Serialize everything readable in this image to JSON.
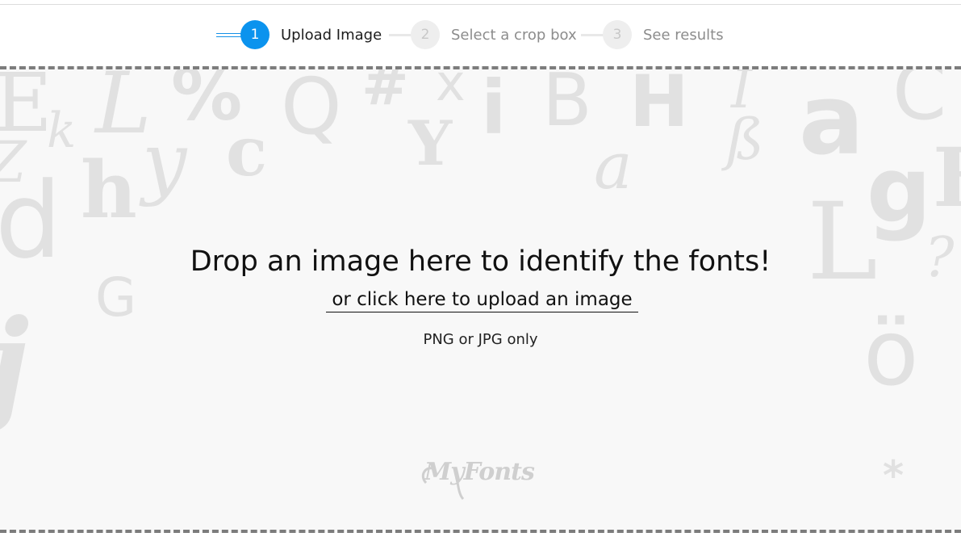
{
  "stepper": {
    "steps": [
      {
        "number": "1",
        "label": "Upload Image",
        "state": "active"
      },
      {
        "number": "2",
        "label": "Select a crop box",
        "state": "inactive"
      },
      {
        "number": "3",
        "label": "See results",
        "state": "inactive"
      }
    ],
    "active_color": "#0b93ee"
  },
  "dropzone": {
    "headline": "Drop an image here to identify the fonts!",
    "upload_link": "or click here to upload an image",
    "formats": "PNG or JPG only",
    "logo": "MyFonts"
  },
  "background_glyphs": [
    "E",
    "k",
    "L",
    "%",
    "Q",
    "#",
    "x",
    "i",
    "B",
    "H",
    "I",
    "a",
    "Y",
    "c",
    "y",
    "h",
    "Z",
    "d",
    "G",
    "j",
    "a",
    "L",
    "g",
    "F",
    "?",
    "ö",
    "*",
    "ß",
    "C"
  ]
}
